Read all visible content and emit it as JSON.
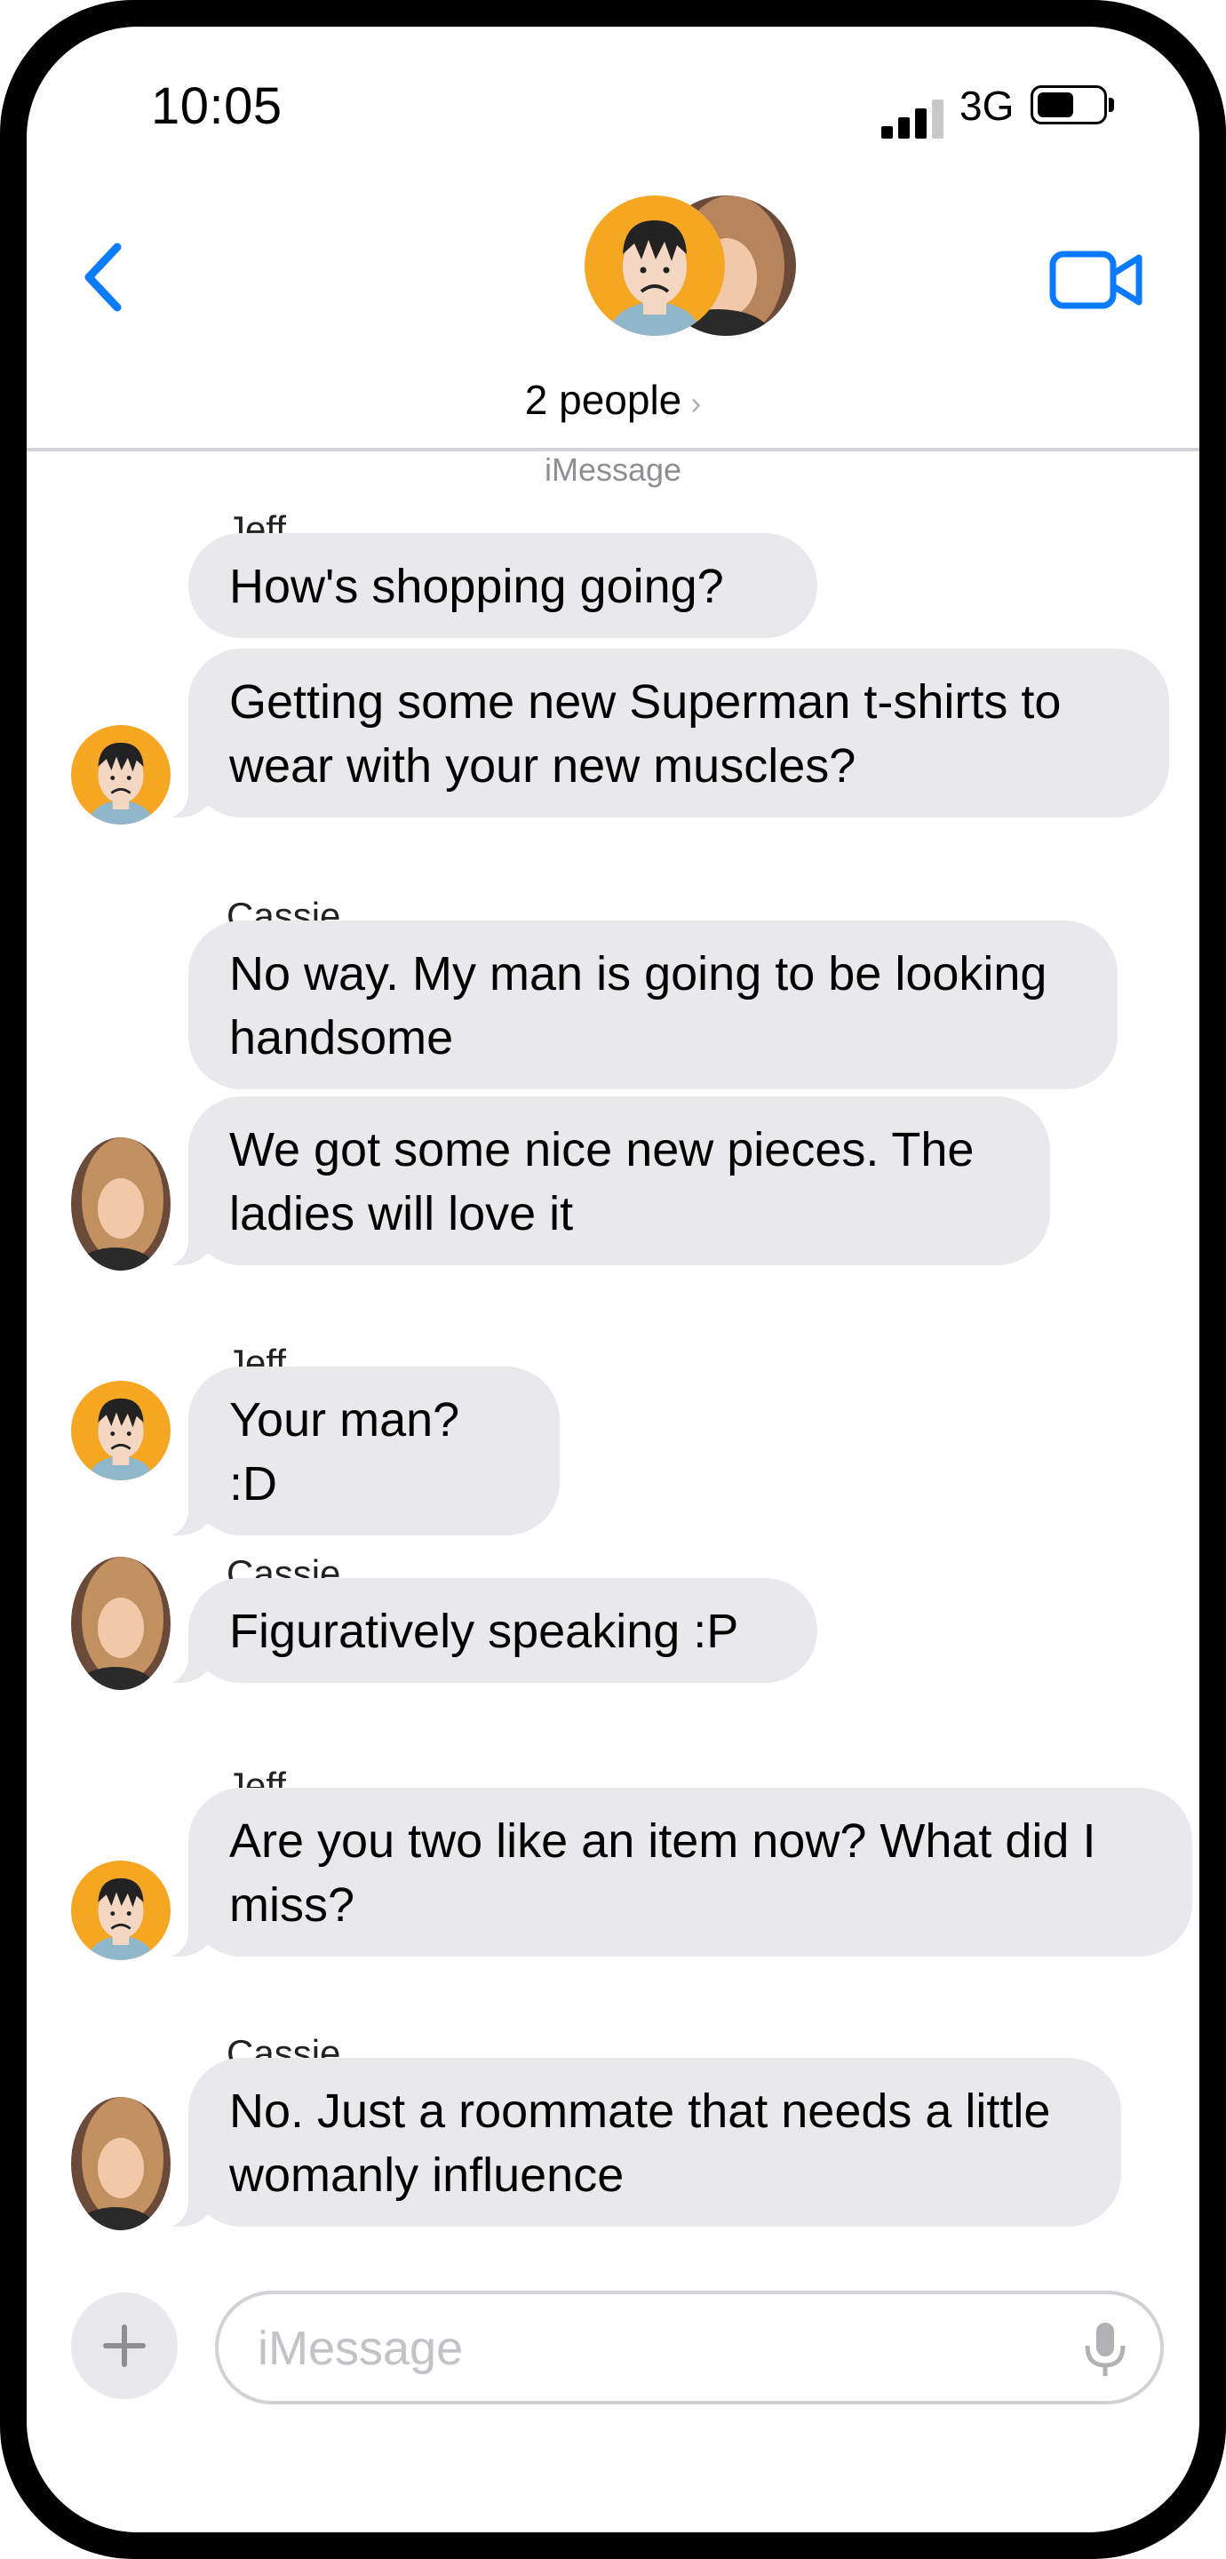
{
  "status_bar": {
    "time": "10:05",
    "network": "3G",
    "battery_level": 0.55
  },
  "header": {
    "title": "2 people",
    "title_chevron": "›",
    "service_label": "iMessage"
  },
  "messages": [
    {
      "sender": "Jeff",
      "text": "How's shopping going?"
    },
    {
      "text": "Getting some new Superman t-shirts to wear with your new muscles?"
    },
    {
      "sender": "Cassie",
      "text": "No way.  My man is going to be looking handsome"
    },
    {
      "text": "We got some nice new pieces.  The ladies will love it"
    },
    {
      "sender": "Jeff",
      "text": "Your man? :D"
    },
    {
      "sender": "Cassie",
      "text": "Figuratively speaking :P"
    },
    {
      "sender": "Jeff",
      "text": "Are you two like an item now?  What did I miss?"
    },
    {
      "sender": "Cassie",
      "text": "No.  Just a roommate that needs a little womanly influence"
    }
  ],
  "input": {
    "placeholder": "iMessage",
    "value": ""
  },
  "icons": {
    "back": "chevron-left-icon",
    "video": "video-camera-icon",
    "add": "plus-icon",
    "mic": "microphone-icon"
  },
  "colors": {
    "accent": "#0a7aff",
    "bubble_incoming": "#e9e9eb",
    "avatar_jeff_bg": "#f5a623"
  }
}
